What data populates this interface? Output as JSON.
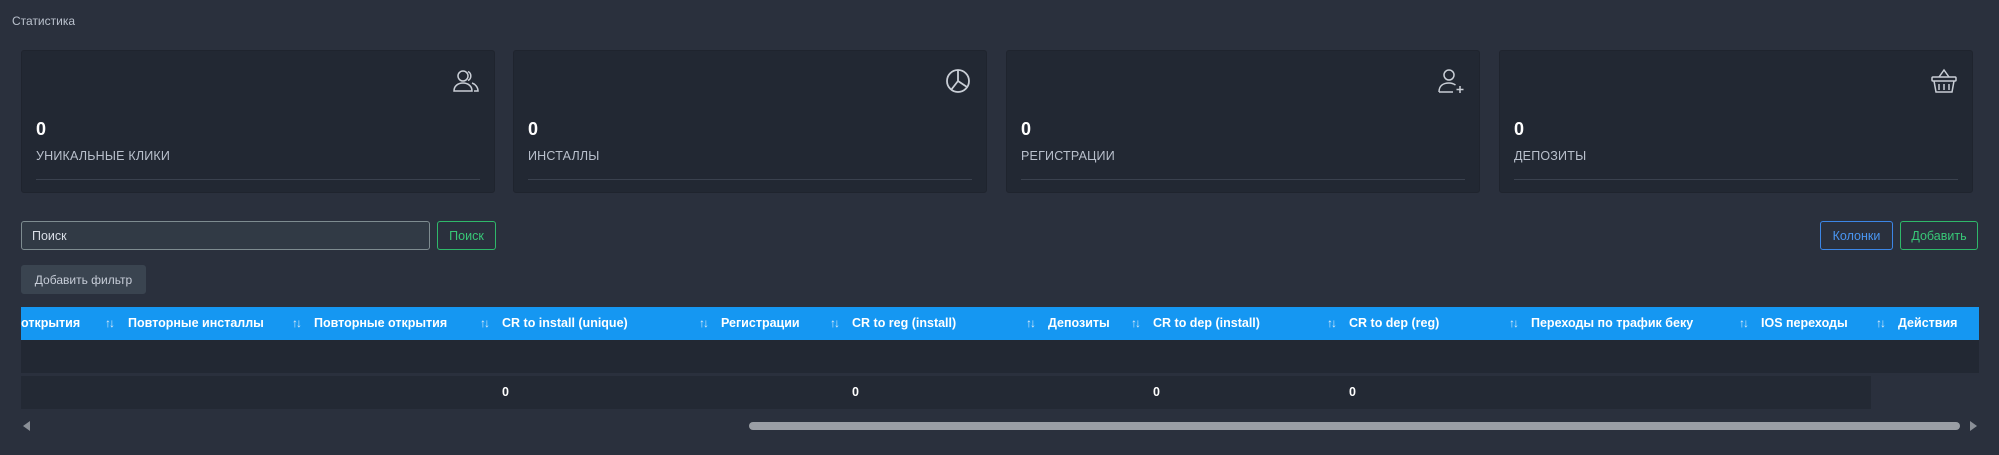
{
  "page": {
    "title": "Статистика"
  },
  "cards": [
    {
      "value": "0",
      "label": "УНИКАЛЬНЫЕ КЛИКИ",
      "icon": "users-icon"
    },
    {
      "value": "0",
      "label": "ИНСТАЛЛЫ",
      "icon": "pie-chart-icon"
    },
    {
      "value": "0",
      "label": "РЕГИСТРАЦИИ",
      "icon": "user-plus-icon"
    },
    {
      "value": "0",
      "label": "ДЕПОЗИТЫ",
      "icon": "basket-icon"
    }
  ],
  "search": {
    "placeholder": "Поиск",
    "button_label": "Поиск"
  },
  "toolbar": {
    "columns_label": "Колонки",
    "add_label": "Добавить",
    "add_filter_label": "Добавить фильтр"
  },
  "table": {
    "columns": [
      "открытия",
      "Повторные инсталлы",
      "Повторные открытия",
      "CR to install (unique)",
      "Регистрации",
      "CR to reg (install)",
      "Депозиты",
      "CR to dep (install)",
      "CR to dep (reg)",
      "Переходы по трафик беку",
      "IOS переходы",
      "Действия"
    ],
    "sort_symbol": "↑↓",
    "totals": [
      "0",
      "0",
      "0",
      "0"
    ]
  },
  "colors": {
    "background": "#2a303d",
    "card": "#222833",
    "header": "#1597f2",
    "success": "#38c777",
    "primary": "#4a95f0"
  }
}
